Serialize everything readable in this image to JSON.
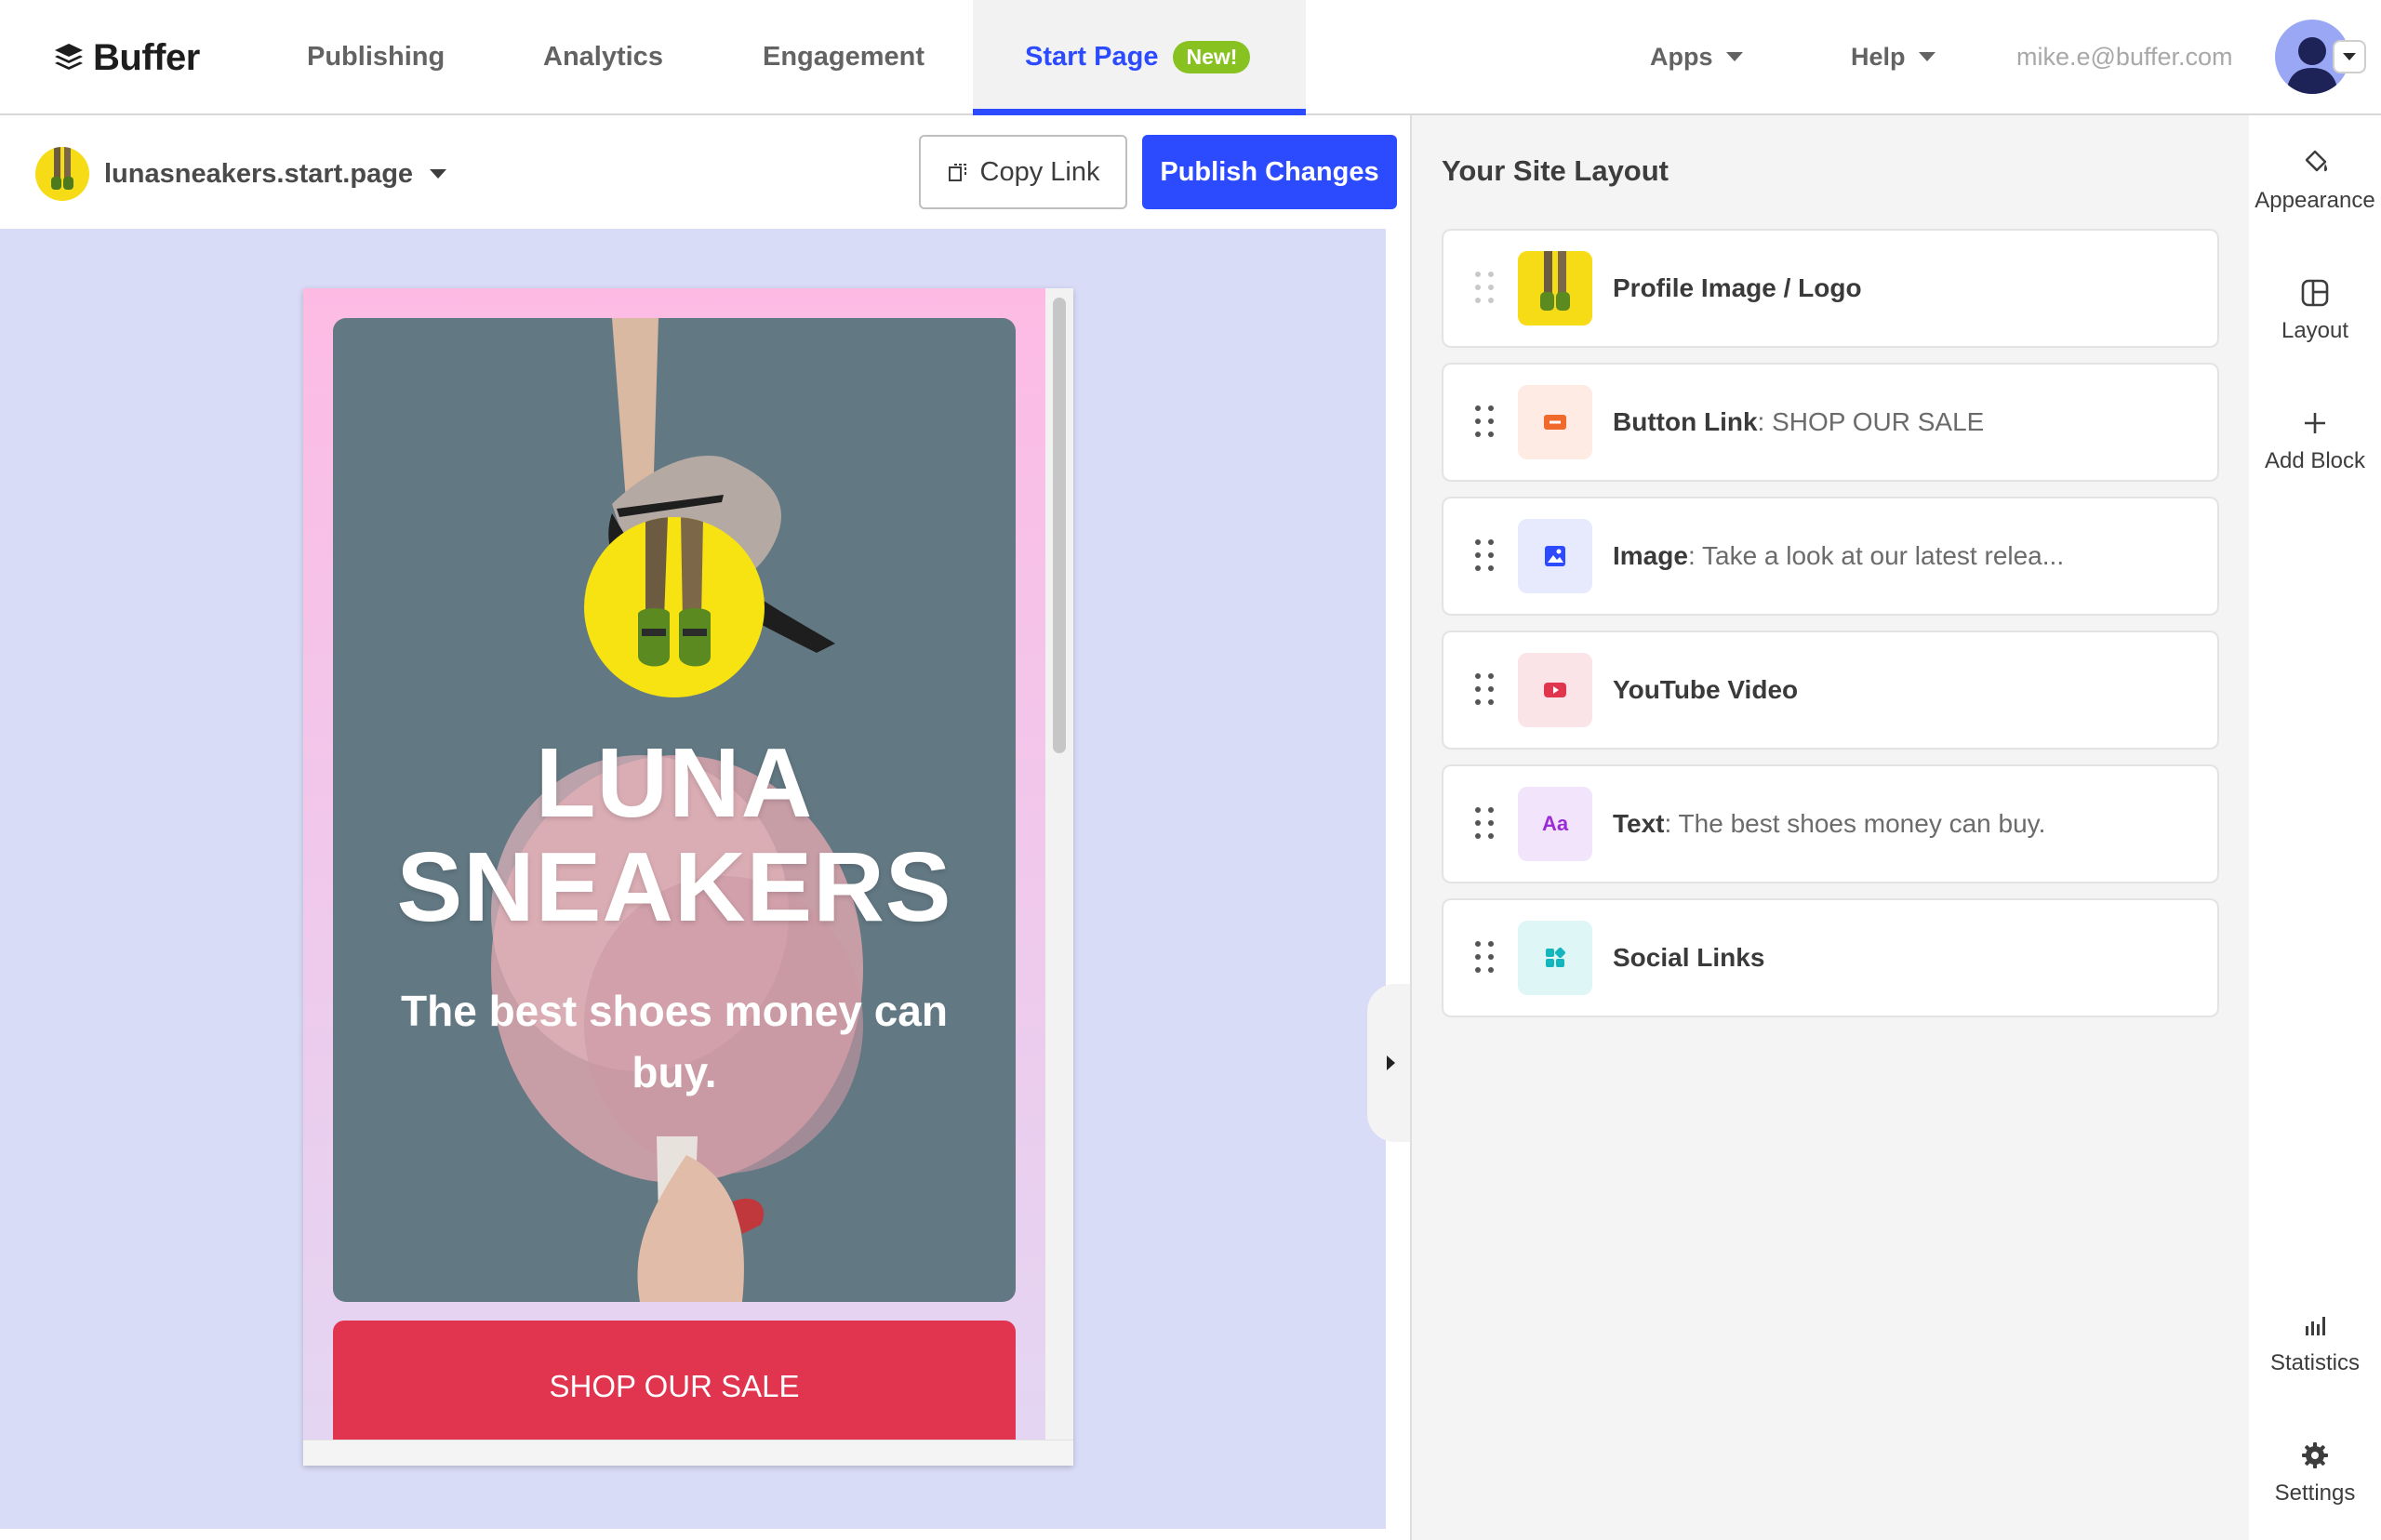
{
  "app": {
    "brand": "Buffer"
  },
  "nav": {
    "items": [
      {
        "label": "Publishing"
      },
      {
        "label": "Analytics"
      },
      {
        "label": "Engagement"
      },
      {
        "label": "Start Page",
        "badge": "New!",
        "active": true
      }
    ],
    "apps_label": "Apps",
    "help_label": "Help",
    "user_email": "mike.e@buffer.com"
  },
  "editor": {
    "site_name": "lunasneakers.start.page",
    "copy_link_label": "Copy Link",
    "publish_label": "Publish Changes"
  },
  "preview": {
    "title_line1": "LUNA",
    "title_line2": "SNEAKERS",
    "subtitle": "The best shoes money can buy.",
    "button_label": "SHOP OUR SALE"
  },
  "layout_panel": {
    "title": "Your Site Layout",
    "blocks": [
      {
        "name": "Profile Image / Logo",
        "detail": "",
        "icon": "profile-image-thumbnail"
      },
      {
        "name": "Button Link",
        "detail": ": SHOP OUR SALE",
        "icon": "button-link-icon"
      },
      {
        "name": "Image",
        "detail": ": Take a look at our latest relea...",
        "icon": "image-icon"
      },
      {
        "name": "YouTube Video",
        "detail": "",
        "icon": "youtube-icon"
      },
      {
        "name": "Text",
        "detail": ": The best shoes money can buy.",
        "icon": "text-icon"
      },
      {
        "name": "Social Links",
        "detail": "",
        "icon": "social-links-icon"
      }
    ]
  },
  "toolbar": {
    "appearance": "Appearance",
    "layout": "Layout",
    "add_block": "Add Block",
    "statistics": "Statistics",
    "settings": "Settings"
  },
  "colors": {
    "accent": "#2c4bff",
    "new_badge": "#87c221",
    "shop_button": "#e0344f",
    "canvas_bg": "#d8dcf6",
    "hero_bg": "#627883"
  }
}
